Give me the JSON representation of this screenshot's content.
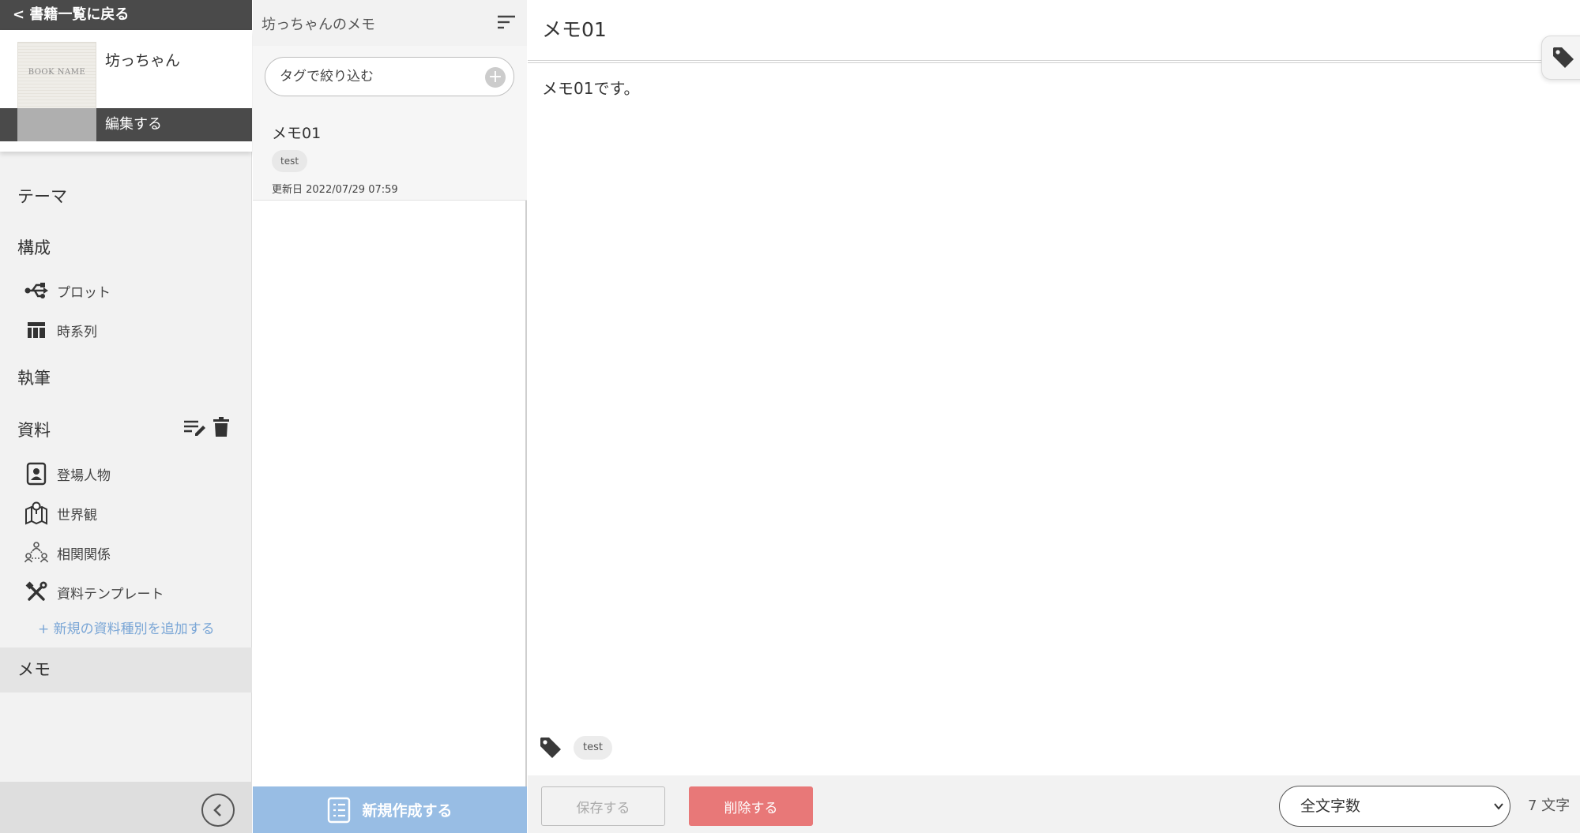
{
  "sidebar": {
    "back_label": "< 書籍一覧に戻る",
    "book": {
      "cover_label": "BOOK NAME",
      "title": "坊っちゃん",
      "edit_label": "編集する"
    },
    "sections": {
      "theme": "テーマ",
      "structure": "構成",
      "writing": "執筆",
      "materials": "資料",
      "memo": "メモ"
    },
    "structure_items": [
      {
        "label": "プロット",
        "icon": "usb-icon"
      },
      {
        "label": "時系列",
        "icon": "table-icon"
      }
    ],
    "material_items": [
      {
        "label": "登場人物",
        "icon": "person-card-icon"
      },
      {
        "label": "世界観",
        "icon": "map-icon"
      },
      {
        "label": "相関関係",
        "icon": "relations-icon"
      },
      {
        "label": "資料テンプレート",
        "icon": "tools-icon"
      }
    ],
    "add_material_type": "+ 新規の資料種別を追加する"
  },
  "memo_list": {
    "title": "坊っちゃんのメモ",
    "tag_filter_placeholder": "タグで絞り込む",
    "items": [
      {
        "title": "メモ01",
        "tag": "test",
        "updated": "更新日 2022/07/29 07:59"
      }
    ],
    "new_label": "新規作成する"
  },
  "editor": {
    "title": "メモ01",
    "body": "メモ01です。",
    "tags": [
      "test"
    ],
    "save_label": "保存する",
    "delete_label": "削除する",
    "count_mode": "全文字数",
    "char_count": "7 文字"
  },
  "colors": {
    "dark_bar": "#4a4a4a",
    "accent_blue": "#98bde4",
    "link_blue": "#7aa6d6",
    "delete_red": "#e87878"
  }
}
